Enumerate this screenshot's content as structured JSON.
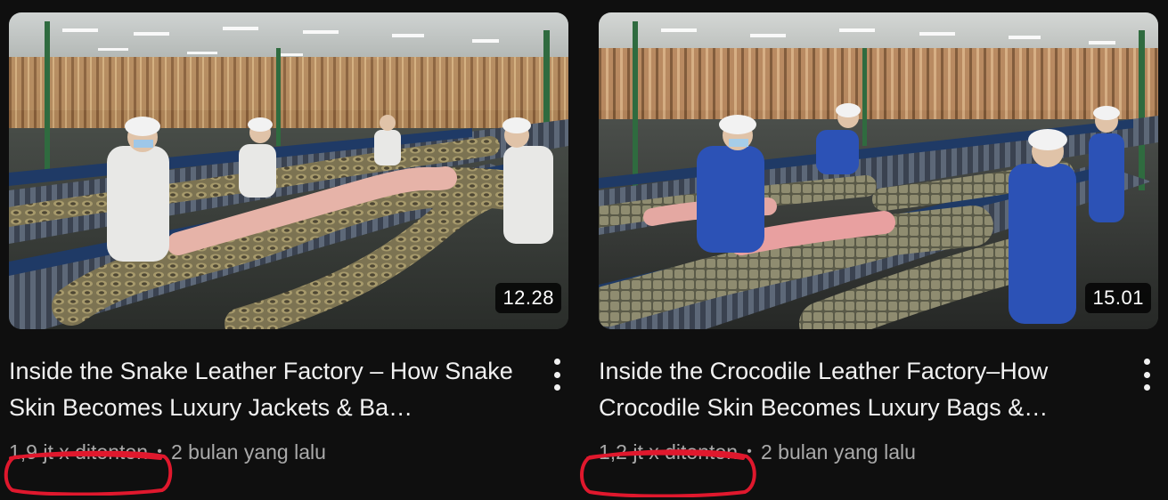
{
  "videos": [
    {
      "title": "Inside the Snake Leather Factory – How Snake Skin Becomes Luxury Jackets & Ba…",
      "duration": "12.28",
      "views": "1,9 jt x ditonton",
      "age": "2 bulan yang lalu",
      "thumbnail_subject": "snake-leather-factory",
      "menu_icon": "more-vertical-icon"
    },
    {
      "title": "Inside the Crocodile Leather Factory–How Crocodile Skin Becomes Luxury Bags &…",
      "duration": "15.01",
      "views": "1,2 jt x ditonton",
      "age": "2 bulan yang lalu",
      "thumbnail_subject": "crocodile-leather-factory",
      "menu_icon": "more-vertical-icon"
    }
  ],
  "separator": "•",
  "annotation_color": "#e0182d",
  "colors": {
    "background": "#0f0f0f",
    "title": "#f1f1f1",
    "meta": "#aaaaaa"
  }
}
